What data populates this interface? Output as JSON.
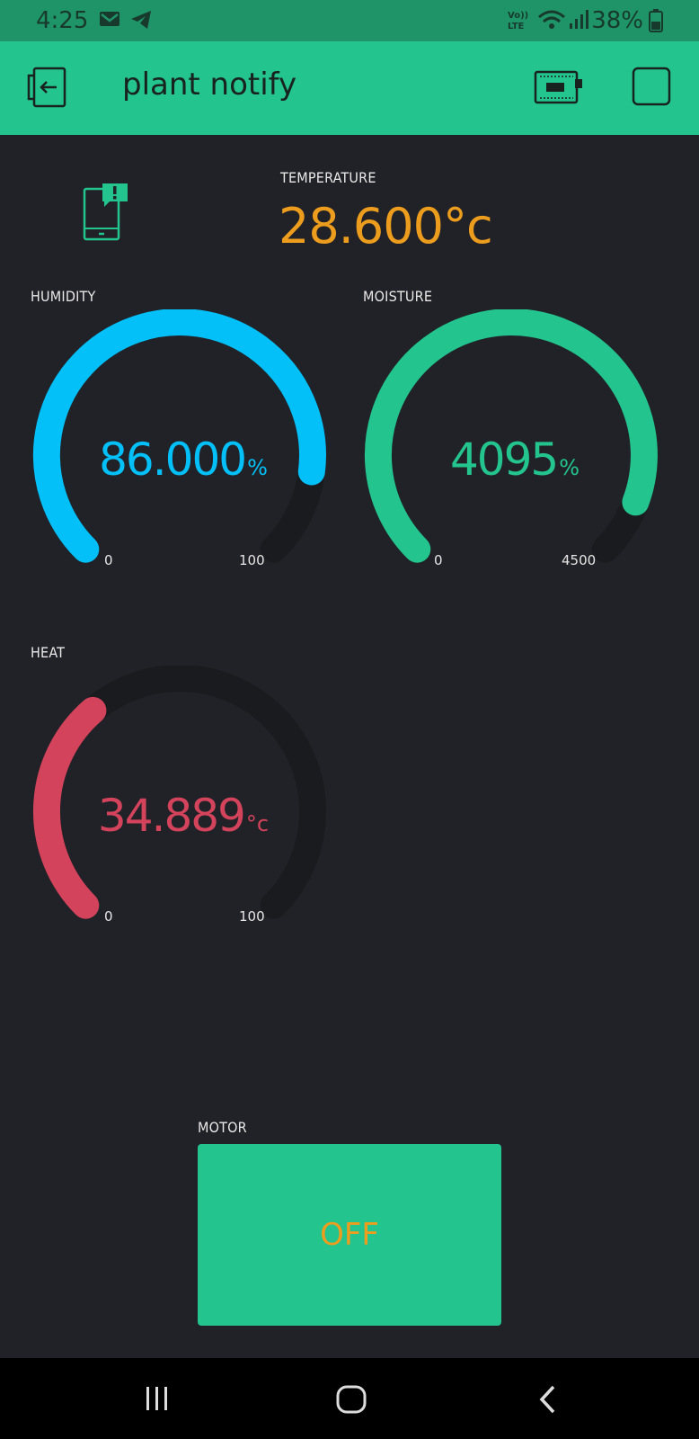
{
  "status_bar": {
    "time": "4:25",
    "battery": "38%",
    "icons": [
      "gmail-icon",
      "telegram-icon",
      "volte-icon",
      "wifi-icon",
      "signal-icon",
      "battery-icon"
    ]
  },
  "app_bar": {
    "title": "plant notify",
    "icons": [
      "exit-icon",
      "device-icon",
      "stop-icon"
    ],
    "background": "#23c48e"
  },
  "notification": {
    "icon": "phone-notification-icon",
    "color": "#23c48e"
  },
  "temperature": {
    "label": "TEMPERATURE",
    "value": "28.600°c",
    "color": "#ed9d1e"
  },
  "gauges": {
    "humidity": {
      "label": "HUMIDITY",
      "value": "86.000",
      "unit": "%",
      "min": "0",
      "max": "100",
      "fraction": 0.86,
      "color": "#04c0f8"
    },
    "moisture": {
      "label": "MOISTURE",
      "value": "4095",
      "unit": "%",
      "min": "0",
      "max": "4500",
      "fraction": 0.91,
      "color": "#23c48e"
    },
    "heat": {
      "label": "HEAT",
      "value": "34.889",
      "unit": "°c",
      "min": "0",
      "max": "100",
      "fraction": 0.349,
      "color": "#d3435c"
    }
  },
  "motor": {
    "label": "MOTOR",
    "state": "OFF",
    "state_color": "#ed9d1e",
    "button_color": "#23c48e"
  },
  "nav_bar": {
    "icons": [
      "recents-icon",
      "home-icon",
      "back-icon"
    ]
  }
}
